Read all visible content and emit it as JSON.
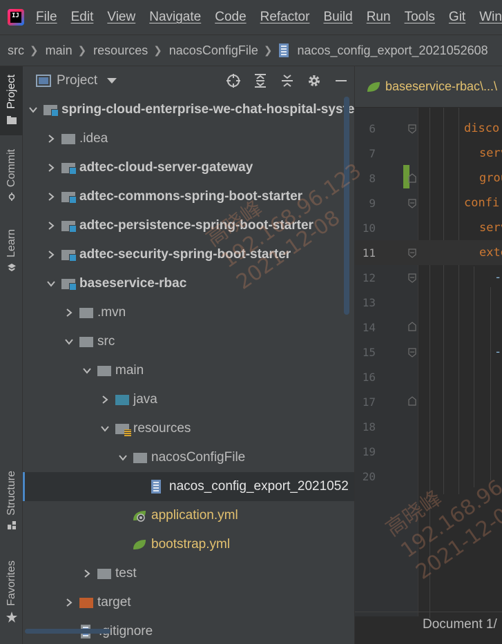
{
  "menubar": {
    "items": [
      "File",
      "Edit",
      "View",
      "Navigate",
      "Code",
      "Refactor",
      "Build",
      "Run",
      "Tools",
      "Git",
      "Wind"
    ]
  },
  "breadcrumb": {
    "items": [
      "src",
      "main",
      "resources",
      "nacosConfigFile",
      "nacos_config_export_2021052608"
    ]
  },
  "toolstrip": {
    "project": "Project",
    "commit": "Commit",
    "learn": "Learn",
    "structure": "Structure",
    "favorites": "Favorites"
  },
  "project_panel": {
    "title": "Project",
    "tree": [
      {
        "label": "spring-cloud-enterprise-we-chat-hospital-syste",
        "expanded": true
      },
      {
        "label": ".idea",
        "expanded": false
      },
      {
        "label": "adtec-cloud-server-gateway",
        "expanded": false
      },
      {
        "label": "adtec-commons-spring-boot-starter",
        "expanded": false
      },
      {
        "label": "adtec-persistence-spring-boot-starter",
        "expanded": false
      },
      {
        "label": "adtec-security-spring-boot-starter",
        "expanded": false
      },
      {
        "label": "baseservice-rbac",
        "expanded": true
      },
      {
        "label": ".mvn",
        "expanded": false
      },
      {
        "label": "src",
        "expanded": true
      },
      {
        "label": "main",
        "expanded": true
      },
      {
        "label": "java",
        "expanded": false
      },
      {
        "label": "resources",
        "expanded": true
      },
      {
        "label": "nacosConfigFile",
        "expanded": true
      },
      {
        "label": "nacos_config_export_2021052",
        "selected": true
      },
      {
        "label": "application.yml"
      },
      {
        "label": "bootstrap.yml"
      },
      {
        "label": "test",
        "expanded": false
      },
      {
        "label": "target",
        "expanded": false
      },
      {
        "label": ".gitignore"
      }
    ]
  },
  "editor": {
    "tab_label": "baseservice-rbac\\...\\",
    "lines": [
      {
        "num": "6",
        "text": "disco"
      },
      {
        "num": "7",
        "text": "serv"
      },
      {
        "num": "8",
        "text": "grou"
      },
      {
        "num": "9",
        "text": "confi"
      },
      {
        "num": "10",
        "text": "serv"
      },
      {
        "num": "11",
        "text": "exte"
      },
      {
        "num": "12",
        "text": "-"
      },
      {
        "num": "13",
        "text": ""
      },
      {
        "num": "14",
        "text": ""
      },
      {
        "num": "15",
        "text": "-"
      },
      {
        "num": "16",
        "text": ""
      },
      {
        "num": "17",
        "text": ""
      },
      {
        "num": "18",
        "text": ""
      },
      {
        "num": "19",
        "text": ""
      },
      {
        "num": "20",
        "text": ""
      }
    ],
    "current_line": "11",
    "status_text": "Document 1/"
  },
  "watermark": {
    "name": "高晓峰",
    "ip": "192.168.96.123",
    "date": "2021-12-08"
  },
  "colors": {
    "panel_bg": "#3c3f41",
    "editor_bg": "#2b2b2b",
    "keyword_orange": "#cc7832",
    "yml_yellow": "#e3c16f",
    "selection_accent": "#4a88c7"
  }
}
